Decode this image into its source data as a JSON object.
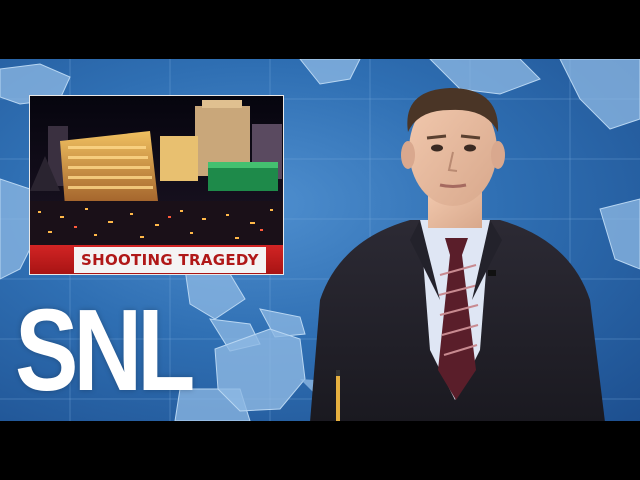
{
  "news_inset": {
    "caption": "SHOOTING TRAGEDY"
  },
  "logo": {
    "text": "SNL"
  },
  "colors": {
    "backdrop_blue": "#2f6fb3",
    "caption_red": "#b01818",
    "logo_white": "#ffffff"
  }
}
